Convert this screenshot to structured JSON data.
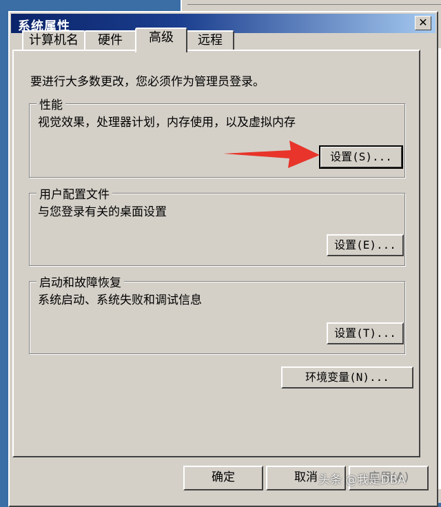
{
  "dialog": {
    "title": "系统属性",
    "close_glyph": "✕"
  },
  "tabs": [
    {
      "label": "计算机名",
      "active": false
    },
    {
      "label": "硬件",
      "active": false
    },
    {
      "label": "高级",
      "active": true
    },
    {
      "label": "远程",
      "active": false
    }
  ],
  "intro": "要进行大多数更改，您必须作为管理员登录。",
  "performance": {
    "title": "性能",
    "desc": "视觉效果，处理器计划，内存使用，以及虚拟内存",
    "button": "设置(S)..."
  },
  "profiles": {
    "title": "用户配置文件",
    "desc": "与您登录有关的桌面设置",
    "button": "设置(E)..."
  },
  "startup": {
    "title": "启动和故障恢复",
    "desc": "系统启动、系统失败和调试信息",
    "button": "设置(T)..."
  },
  "env_button": "环境变量(N)...",
  "footer": {
    "ok": "确定",
    "cancel": "取消",
    "apply": "应用(A)"
  },
  "watermark": "头条 @我是DBA",
  "colors": {
    "titlebar": "#0a246a",
    "face": "#d4d0c8",
    "arrow": "#e8342a"
  }
}
